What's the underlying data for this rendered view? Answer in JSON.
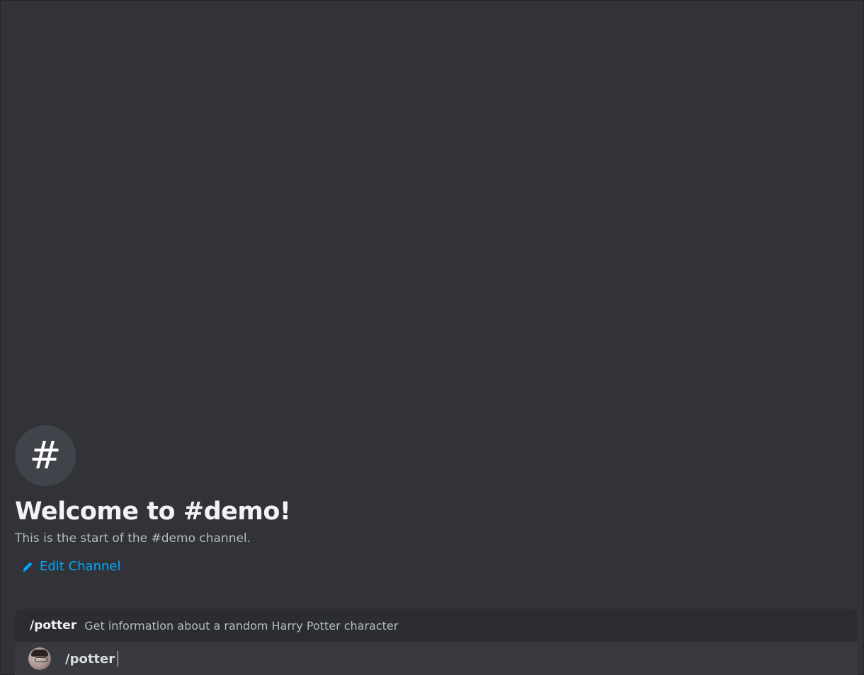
{
  "channel": {
    "icon": "hash-icon",
    "icon_glyph": "#",
    "welcome_title": "Welcome to #demo!",
    "welcome_subtitle": "This is the start of the #demo channel.",
    "edit_label": "Edit Channel"
  },
  "autocomplete": {
    "command": "/potter",
    "description": "Get information about a random Harry Potter character"
  },
  "composer": {
    "value": "/potter"
  },
  "colors": {
    "background": "#313338",
    "link": "#00a8fc",
    "autocomplete_bg": "#2b2d31",
    "composer_bg": "#383a40"
  }
}
